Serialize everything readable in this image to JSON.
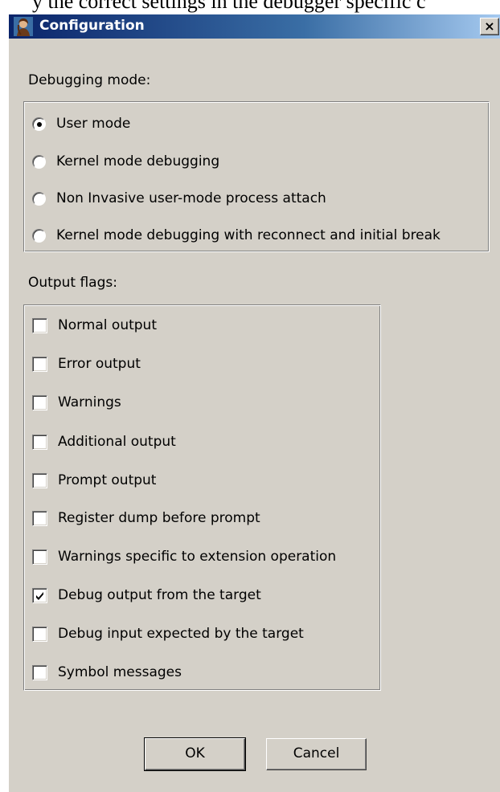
{
  "page_fragment": "y the correct settings in the debugger specific c",
  "window": {
    "title": "Configuration",
    "close_label": "×"
  },
  "debugging_mode": {
    "label": "Debugging mode:",
    "options": [
      {
        "label": "User mode",
        "selected": true
      },
      {
        "label": "Kernel mode debugging",
        "selected": false
      },
      {
        "label": "Non Invasive user-mode process attach",
        "selected": false
      },
      {
        "label": "Kernel mode debugging with reconnect and initial break",
        "selected": false
      }
    ]
  },
  "output_flags": {
    "label": "Output flags:",
    "items": [
      {
        "label": "Normal output",
        "checked": false
      },
      {
        "label": "Error output",
        "checked": false
      },
      {
        "label": "Warnings",
        "checked": false
      },
      {
        "label": "Additional output",
        "checked": false
      },
      {
        "label": "Prompt output",
        "checked": false
      },
      {
        "label": "Register dump before prompt",
        "checked": false
      },
      {
        "label": "Warnings specific to extension operation",
        "checked": false
      },
      {
        "label": "Debug output from the target",
        "checked": true
      },
      {
        "label": "Debug input expected by the target",
        "checked": false
      },
      {
        "label": "Symbol messages",
        "checked": false
      }
    ]
  },
  "buttons": {
    "ok": "OK",
    "cancel": "Cancel"
  }
}
